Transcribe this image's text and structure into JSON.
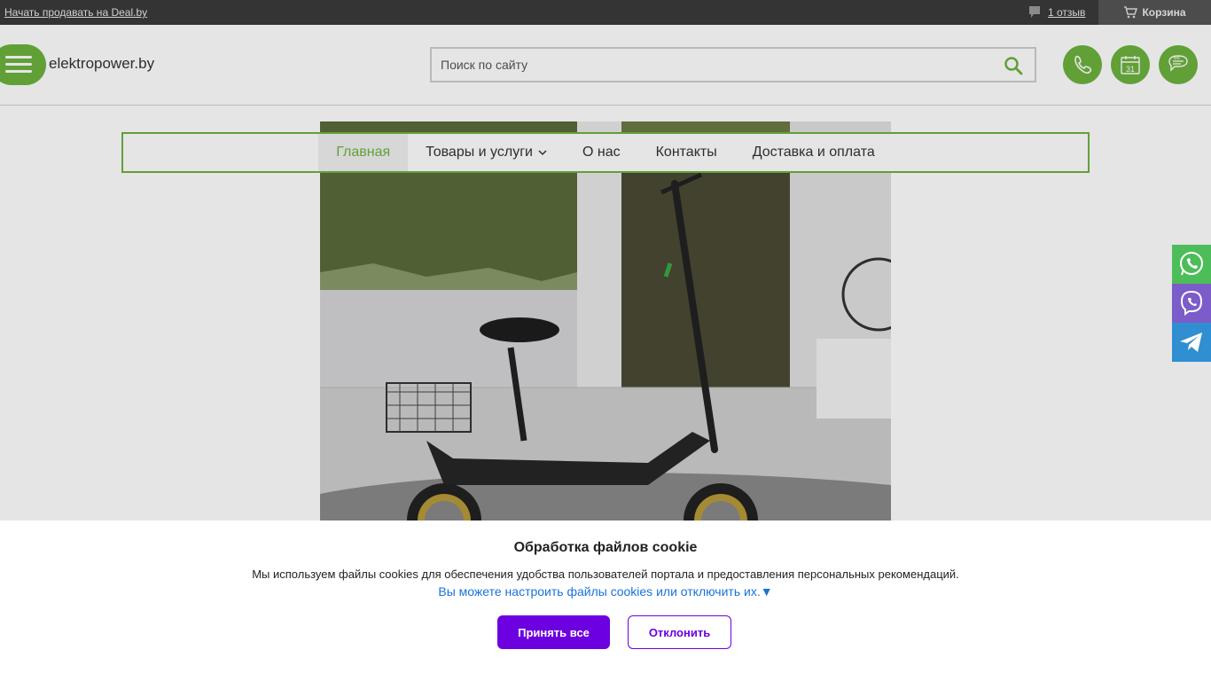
{
  "topbar": {
    "sell_link": "Начать продавать на Deal.by",
    "reviews": "1 отзыв",
    "cart": "Корзина"
  },
  "header": {
    "site_name": "elektropower.by",
    "search_placeholder": "Поиск по сайту",
    "calendar_day": "31"
  },
  "nav": {
    "items": [
      {
        "label": "Главная",
        "active": true
      },
      {
        "label": "Товары и услуги",
        "dropdown": true
      },
      {
        "label": "О нас"
      },
      {
        "label": "Контакты"
      },
      {
        "label": "Доставка и оплата"
      }
    ]
  },
  "cookie": {
    "title": "Обработка файлов cookie",
    "description": "Мы используем файлы cookies для обеспечения удобства пользователей портала и предоставления персональных рекомендаций.",
    "settings_link": "Вы можете настроить файлы cookies или отключить их.▼",
    "accept_label": "Принять все",
    "decline_label": "Отклонить"
  },
  "colors": {
    "brand_green": "#6cb33e",
    "accept_purple": "#6c00e0",
    "link_blue": "#1a73d9",
    "whatsapp": "#4dbd5a",
    "viber": "#7b5cc9",
    "telegram": "#2f8fd0"
  },
  "icons": [
    "comment-icon",
    "cart-icon",
    "burger-icon",
    "search-icon",
    "phone-icon",
    "calendar-icon",
    "chat-quote-icon",
    "whatsapp-icon",
    "viber-icon",
    "telegram-icon",
    "chevron-down-icon"
  ]
}
